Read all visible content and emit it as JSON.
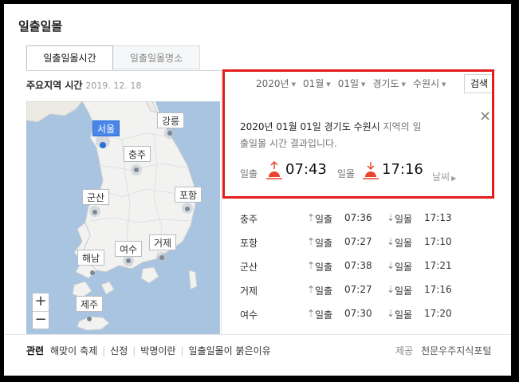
{
  "title": "일출일몰",
  "tabs": [
    {
      "label": "일출일몰시간"
    },
    {
      "label": "일출일몰명소"
    }
  ],
  "subheader": {
    "label": "주요지역 시간",
    "date": "2019. 12. 18"
  },
  "selectors": [
    {
      "value": "2020년"
    },
    {
      "value": "01월"
    },
    {
      "value": "01일"
    },
    {
      "value": "경기도"
    },
    {
      "value": "수원시"
    }
  ],
  "search_label": "검색",
  "map": {
    "labels": [
      {
        "name": "서울",
        "active": true
      },
      {
        "name": "강릉"
      },
      {
        "name": "충주"
      },
      {
        "name": "군산"
      },
      {
        "name": "포항"
      },
      {
        "name": "여수"
      },
      {
        "name": "거제"
      },
      {
        "name": "해남"
      },
      {
        "name": "제주"
      }
    ],
    "zoom_in": "+",
    "zoom_out": "−"
  },
  "result": {
    "line1_em": "2020년 01월 01일 경기도 수원시",
    "line1_rest": " 지역의 일",
    "line2": "출일몰 시간 결과입니다.",
    "sunrise_label": "일출",
    "sunrise_time": "07:43",
    "sunset_label": "일몰",
    "sunset_time": "17:16",
    "weather_link": "날씨",
    "close_icon": "close-icon"
  },
  "city_list": [
    {
      "city": "충주",
      "rise_label": "일출",
      "rise": "07:36",
      "set_label": "일몰",
      "set": "17:13"
    },
    {
      "city": "포항",
      "rise_label": "일출",
      "rise": "07:27",
      "set_label": "일몰",
      "set": "17:10"
    },
    {
      "city": "군산",
      "rise_label": "일출",
      "rise": "07:38",
      "set_label": "일몰",
      "set": "17:21"
    },
    {
      "city": "거제",
      "rise_label": "일출",
      "rise": "07:27",
      "set_label": "일몰",
      "set": "17:16"
    },
    {
      "city": "여수",
      "rise_label": "일출",
      "rise": "07:30",
      "set_label": "일몰",
      "set": "17:20"
    }
  ],
  "related": {
    "label": "관련",
    "links": [
      "해맞이 축제",
      "신정",
      "박명이란",
      "일출일몰이 붉은이유"
    ]
  },
  "provider": {
    "label": "제공",
    "name": "천문우주지식포털"
  },
  "colors": {
    "highlight_border": "#e31b1b",
    "active_label": "#4a86e8",
    "sun_icon": "#e8452c",
    "sea": "#a9c4e0",
    "land": "#f2f2f0"
  }
}
